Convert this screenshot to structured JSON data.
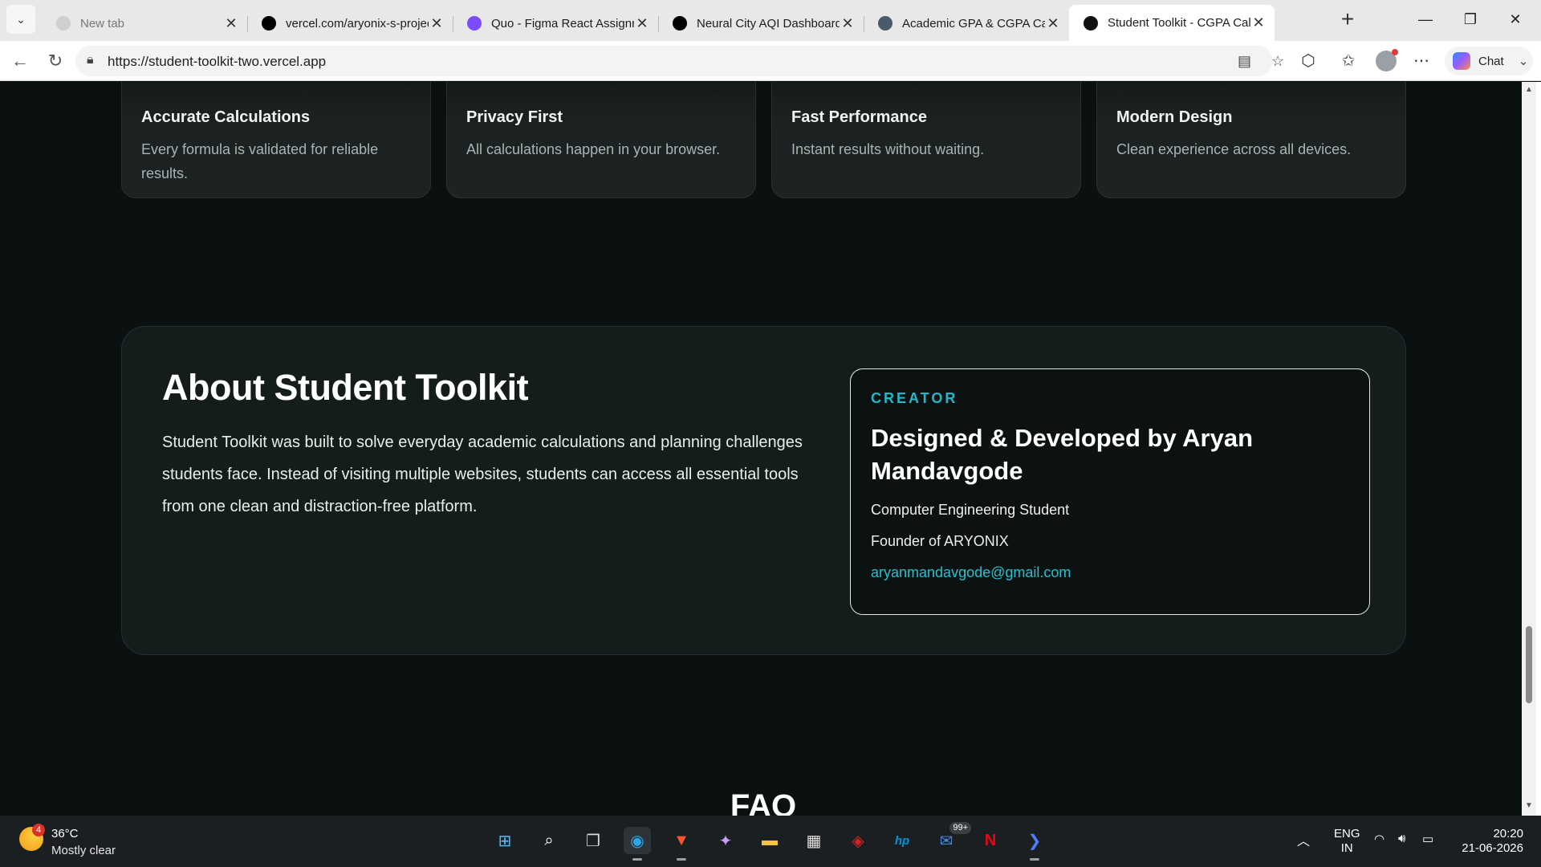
{
  "browser": {
    "tabs": [
      {
        "title": "New tab",
        "icon": "new-tab-page-icon",
        "favicon_color": "#cfcfcf",
        "state": "muted"
      },
      {
        "title": "vercel.com/aryonix-s-projects",
        "icon": "vercel-icon",
        "favicon_color": "#000000",
        "state": "normal"
      },
      {
        "title": "Quo - Figma React Assignment",
        "icon": "figma-bolt-icon",
        "favicon_color": "#7b4dff",
        "state": "normal"
      },
      {
        "title": "Neural City AQI Dashboard",
        "icon": "vercel-icon",
        "favicon_color": "#000000",
        "state": "normal"
      },
      {
        "title": "Academic GPA & CGPA Calculator",
        "icon": "document-icon",
        "favicon_color": "#4b5a68",
        "state": "normal"
      },
      {
        "title": "Student Toolkit - CGPA Calculator",
        "icon": "student-toolkit-icon",
        "favicon_color": "#111111",
        "state": "active"
      }
    ],
    "url": "https://student-toolkit-two.vercel.app",
    "chat_label": "Chat"
  },
  "features": [
    {
      "title": "Accurate Calculations",
      "desc": "Every formula is validated for reliable results."
    },
    {
      "title": "Privacy First",
      "desc": "All calculations happen in your browser."
    },
    {
      "title": "Fast Performance",
      "desc": "Instant results without waiting."
    },
    {
      "title": "Modern Design",
      "desc": "Clean experience across all devices."
    }
  ],
  "about": {
    "heading": "About Student Toolkit",
    "description": "Student Toolkit was built to solve everyday academic calculations and planning challenges students face. Instead of visiting multiple websites, students can access all essential tools from one clean and distraction-free platform.",
    "creator": {
      "tag": "CREATOR",
      "title": "Designed & Developed by Aryan Mandavgode",
      "role": "Computer Engineering Student",
      "founder": "Founder of ARYONIX",
      "email": "aryanmandavgode@gmail.com"
    }
  },
  "faq_heading": "FAQ",
  "taskbar": {
    "weather_temp": "36°C",
    "weather_desc": "Mostly clear",
    "weather_badge": "4",
    "apps": [
      {
        "name": "start-icon",
        "glyph": "⊞",
        "color": "#4cc2ff"
      },
      {
        "name": "search-icon",
        "glyph": "⌕",
        "color": "#ffffff"
      },
      {
        "name": "task-view-icon",
        "glyph": "❐",
        "color": "#d8d8d8"
      },
      {
        "name": "edge-icon",
        "glyph": "◉",
        "color": "#2ba6e8"
      },
      {
        "name": "brave-icon",
        "glyph": "▼",
        "color": "#fb542b"
      },
      {
        "name": "copilot-icon",
        "glyph": "✦",
        "color": "#c89bff"
      },
      {
        "name": "file-explorer-icon",
        "glyph": "▬",
        "color": "#f5c242"
      },
      {
        "name": "store-icon",
        "glyph": "▦",
        "color": "#e0e0e0"
      },
      {
        "name": "mcafee-icon",
        "glyph": "◈",
        "color": "#d8232a"
      },
      {
        "name": "hp-icon",
        "glyph": "hp",
        "color": "#0096d6"
      },
      {
        "name": "mail-icon",
        "glyph": "✉",
        "color": "#3f8ee8"
      },
      {
        "name": "netflix-icon",
        "glyph": "N",
        "color": "#e50914"
      },
      {
        "name": "terminal-icon",
        "glyph": "❯",
        "color": "#4d7cff"
      }
    ],
    "mail_badge": "99+",
    "lang_top": "ENG",
    "lang_bottom": "IN",
    "time": "20:20",
    "date": "21-06-2026"
  }
}
